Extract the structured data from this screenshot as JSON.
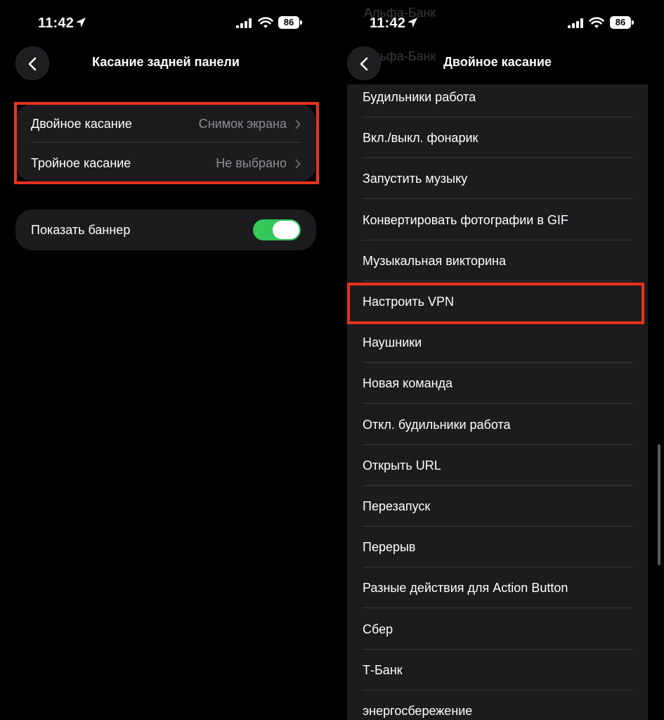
{
  "status_bar": {
    "time": "11:42",
    "battery": "86"
  },
  "left_screen": {
    "title": "Касание задней панели",
    "tap_settings": [
      {
        "label": "Двойное касание",
        "value": "Снимок экрана"
      },
      {
        "label": "Тройное касание",
        "value": "Не выбрано"
      }
    ],
    "banner": {
      "label": "Показать баннер",
      "enabled": true
    }
  },
  "right_screen": {
    "title": "Двойное касание",
    "scrolled_behind_header": [
      "Альфа-Банк"
    ],
    "actions": [
      "Будильники работа",
      "Вкл./выкл. фонарик",
      "Запустить музыку",
      "Конвертировать фотографии в GIF",
      "Музыкальная викторина",
      "Настроить VPN",
      "Наушники",
      "Новая команда",
      "Откл. будильники работа",
      "Открыть URL",
      "Перезапуск",
      "Перерыв",
      "Разные действия для Action Button",
      "Сбер",
      "Т-Банк",
      "энергосбережение"
    ],
    "highlighted_action": "Настроить VPN"
  },
  "colors": {
    "highlight": "#e8321e",
    "toggle_on": "#34c759"
  }
}
